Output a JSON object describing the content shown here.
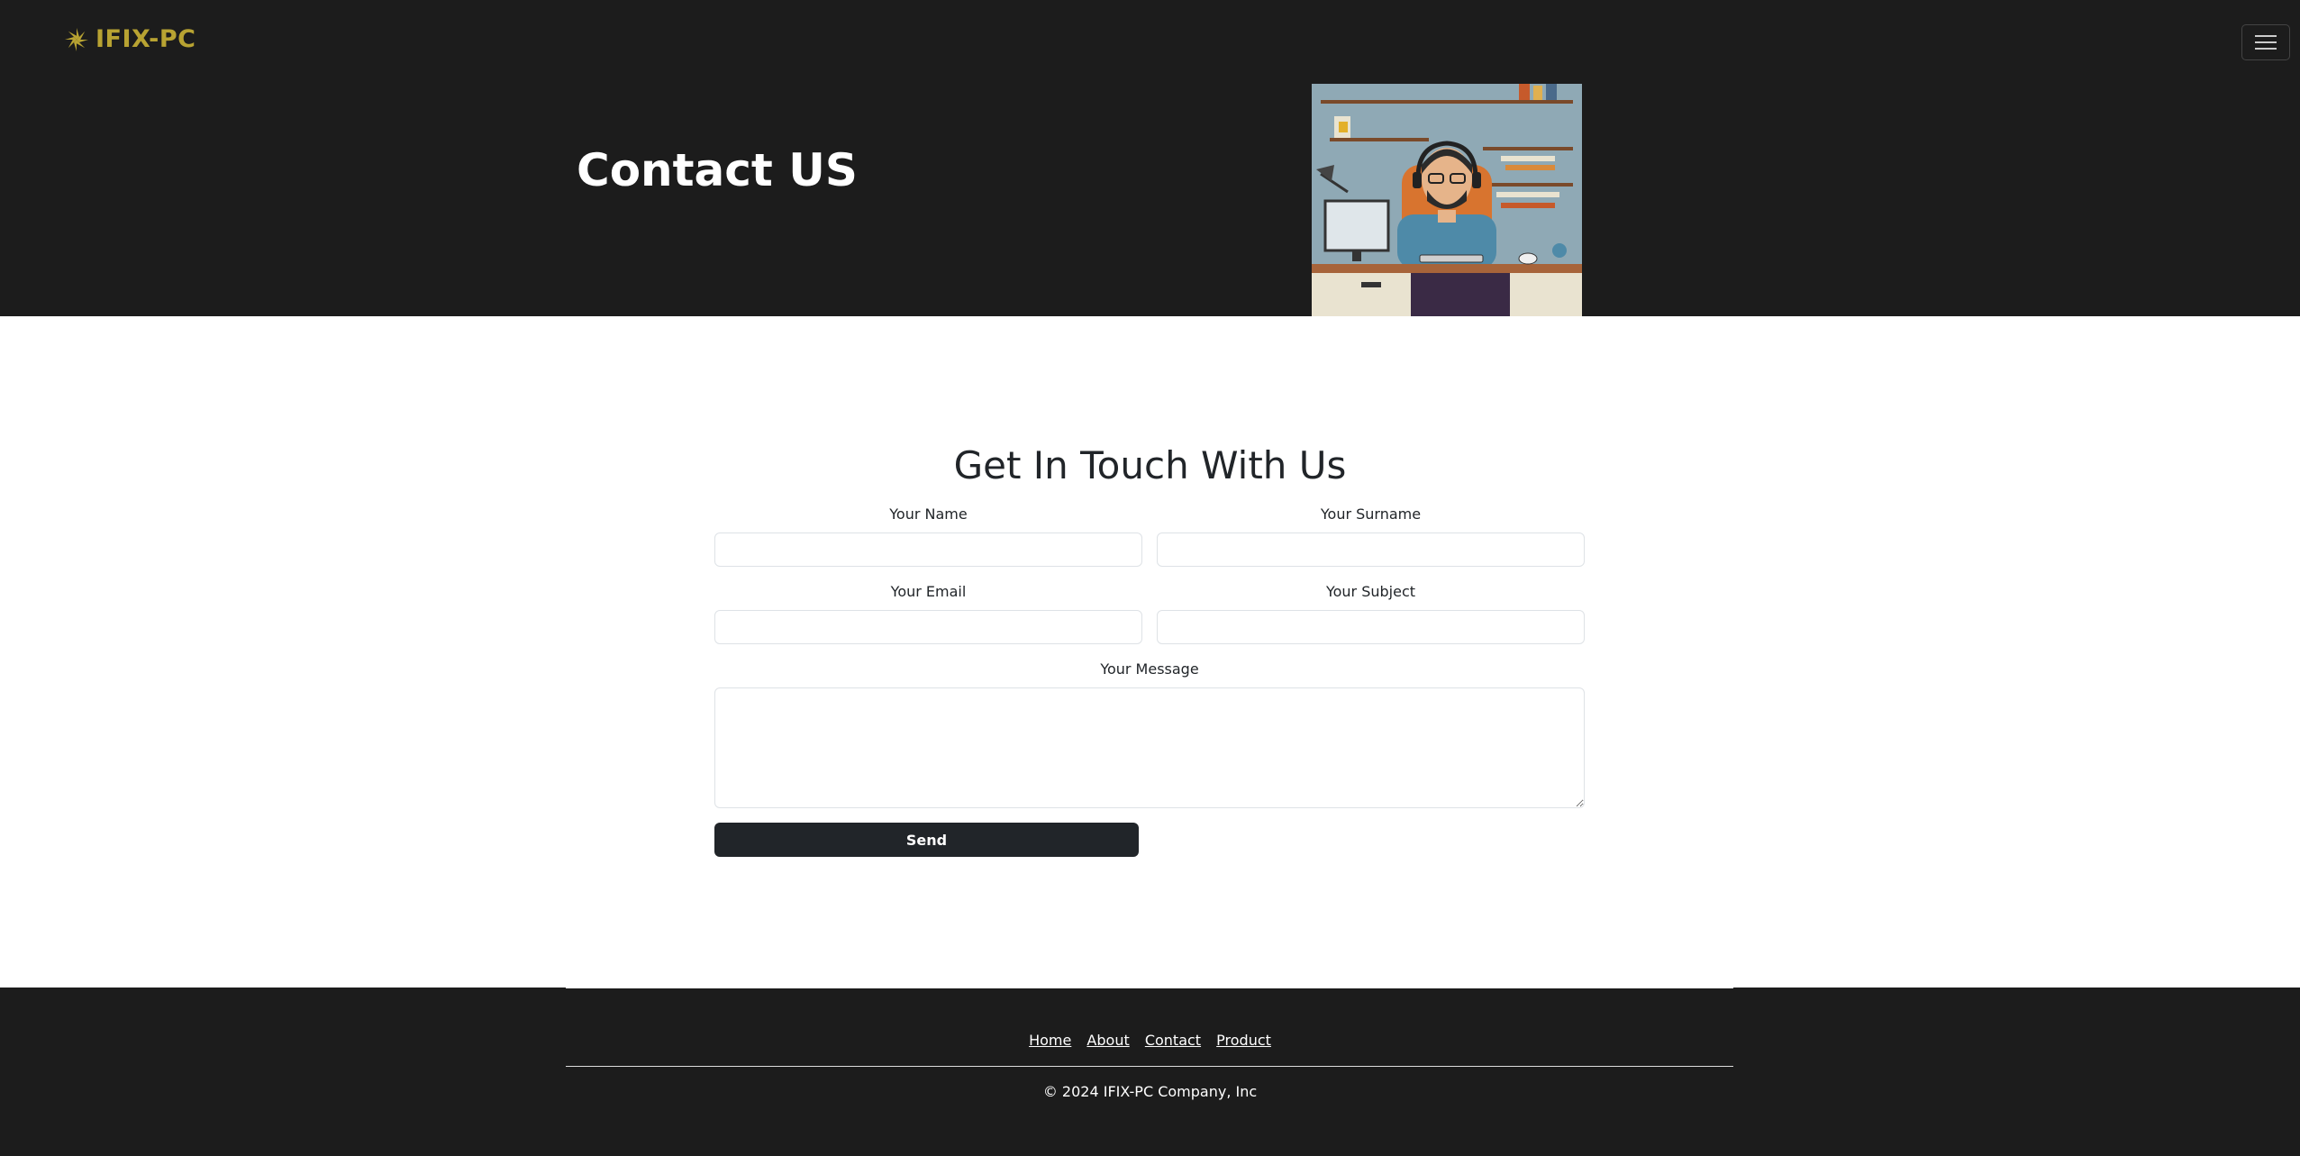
{
  "navbar": {
    "brand": "IFIX-PC",
    "brand_color": "#b8a332",
    "logo_icon": "spark-logo-icon",
    "menu_icon": "hamburger-menu-icon"
  },
  "hero": {
    "title": "Contact US",
    "image": "illustration of man with headset at computer desk"
  },
  "form": {
    "title": "Get In Touch With Us",
    "name_label": "Your Name",
    "surname_label": "Your Surname",
    "email_label": "Your Email",
    "subject_label": "Your Subject",
    "message_label": "Your Message",
    "name_value": "",
    "surname_value": "",
    "email_value": "",
    "subject_value": "",
    "message_value": "",
    "send_label": "Send"
  },
  "footer": {
    "links": [
      "Home",
      "About",
      "Contact",
      "Product"
    ],
    "copyright": "© 2024 IFIX-PC Company, Inc"
  },
  "colors": {
    "dark_bg": "#1c1c1c",
    "button_bg": "#212529"
  }
}
